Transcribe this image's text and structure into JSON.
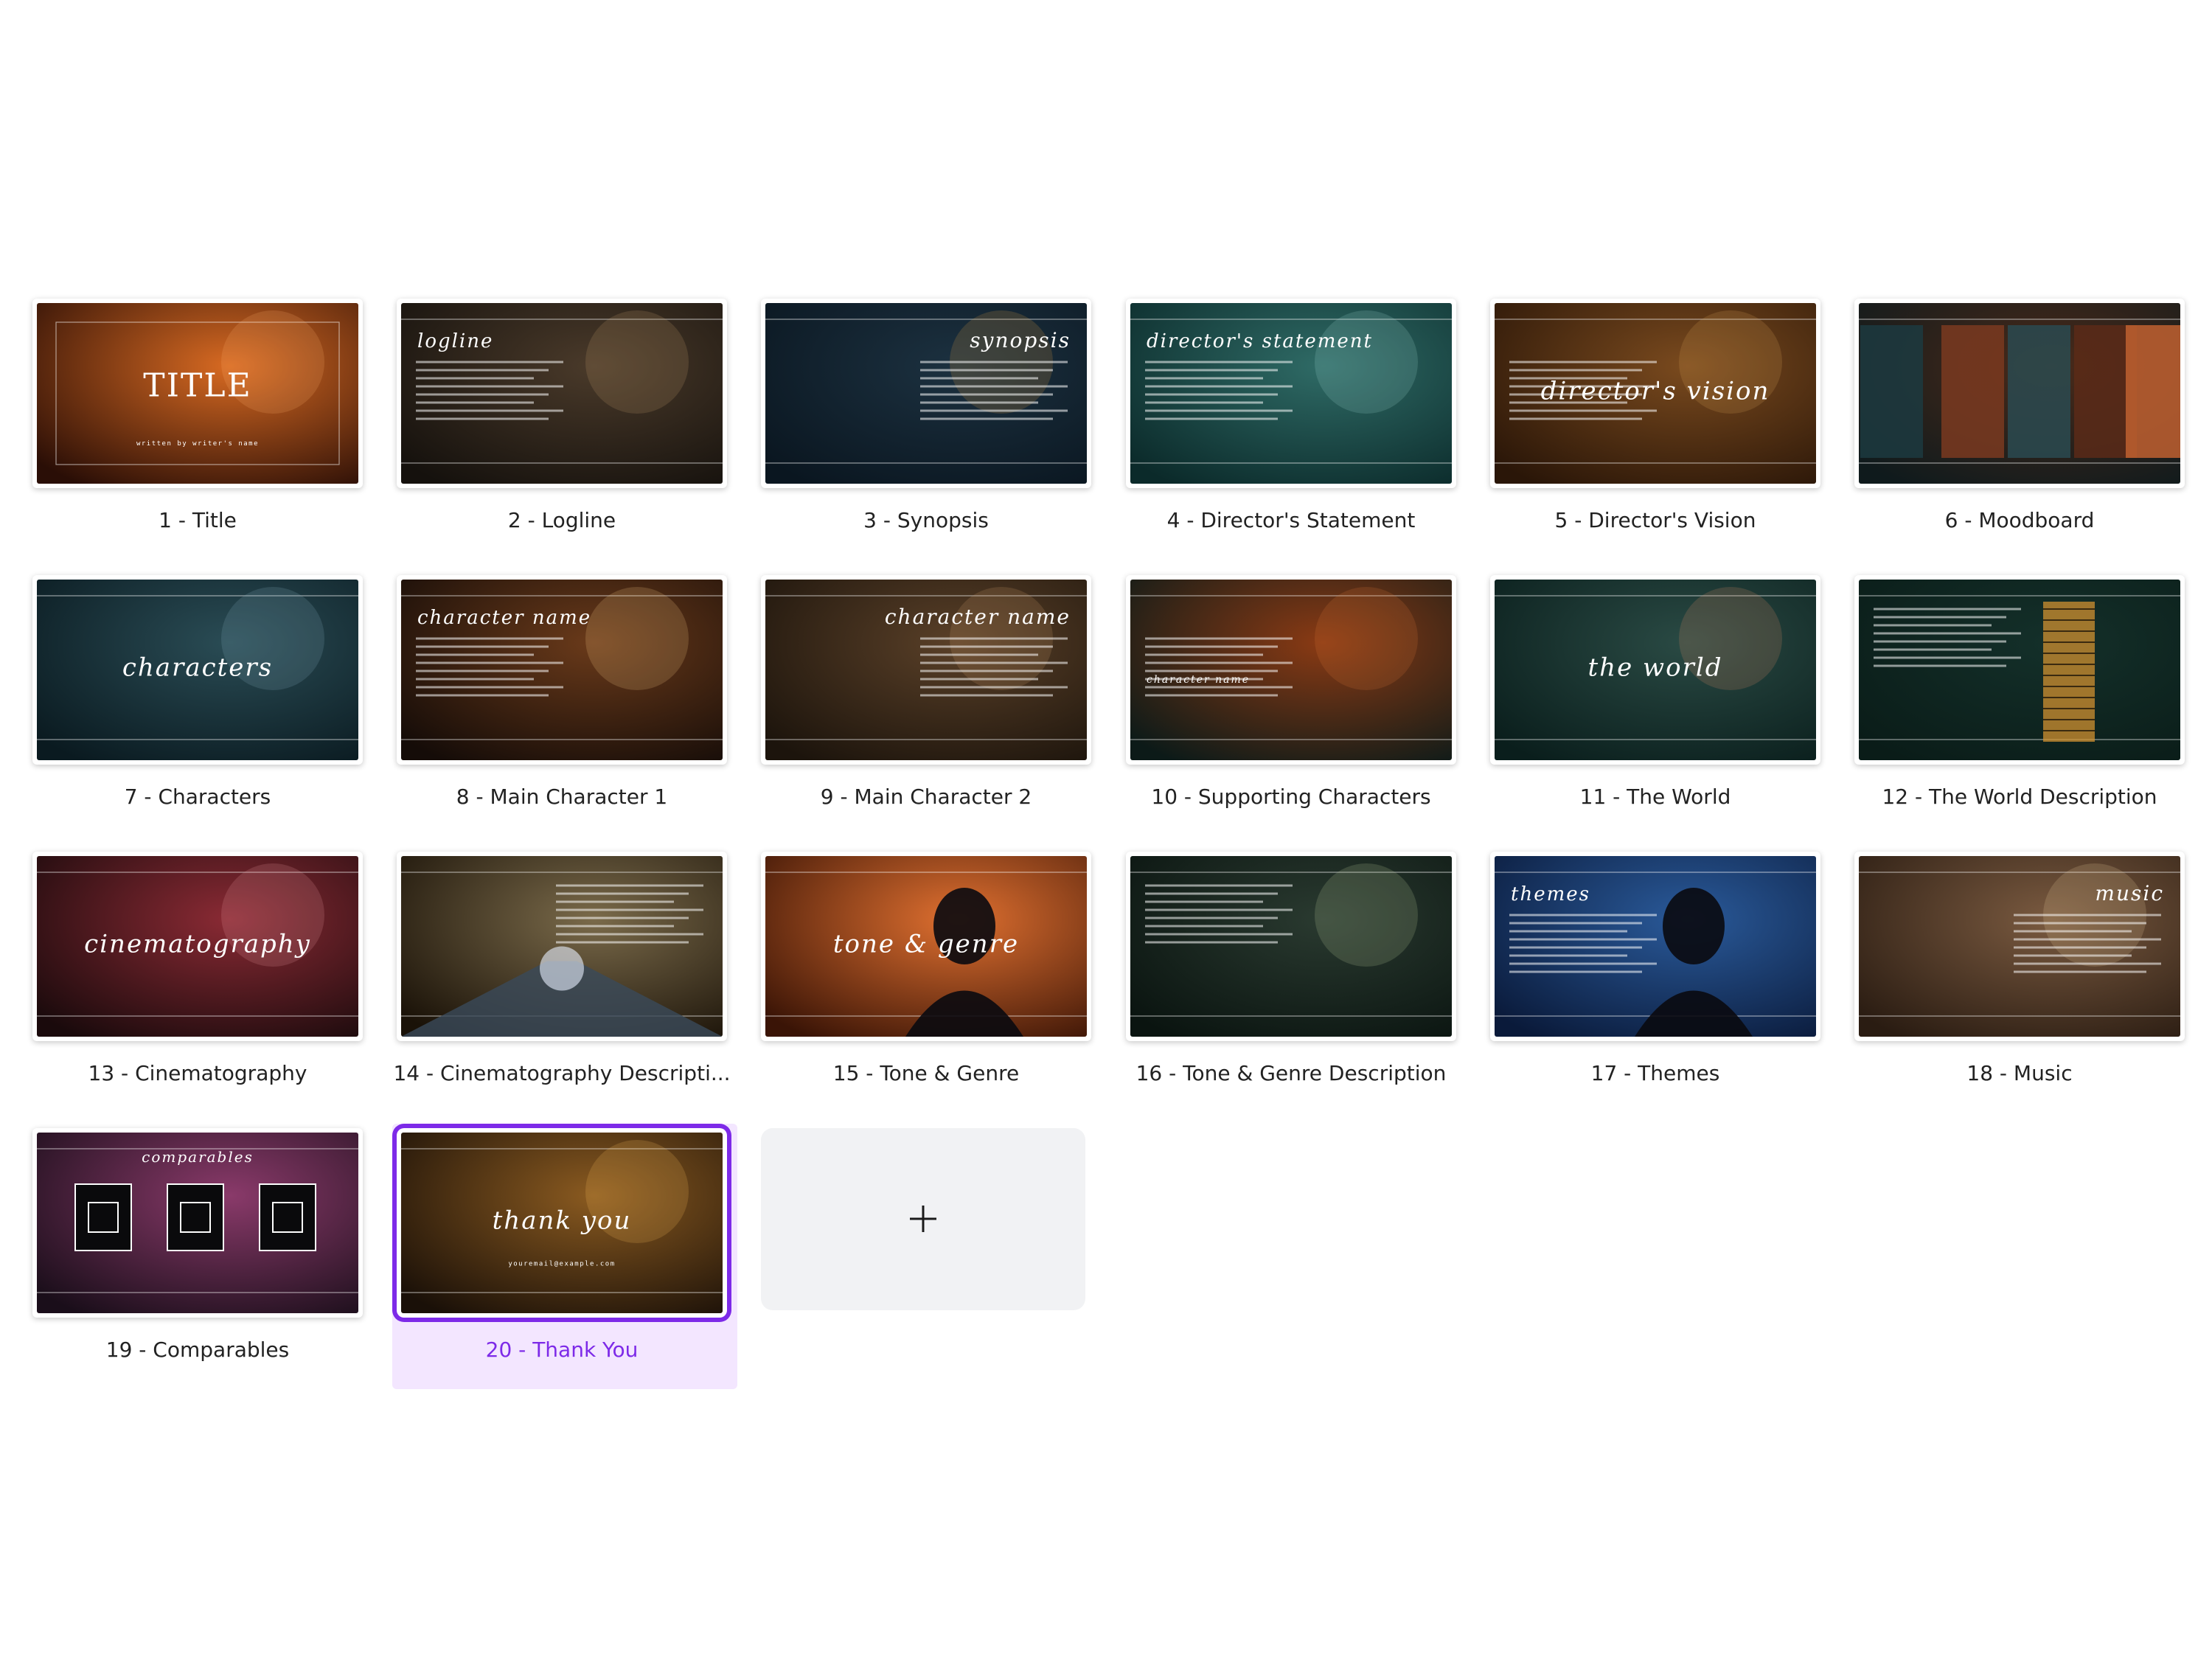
{
  "slides": [
    {
      "label": "1 - Title",
      "bg": [
        "#2a0e06",
        "#d86a22"
      ],
      "accent": "#ffb070",
      "heading": "TITLE",
      "heading_style": "upright",
      "sub": "written by writer's name",
      "body": false,
      "thumb_icon": "none"
    },
    {
      "label": "2 - Logline",
      "bg": [
        "#15110d",
        "#4a3a2a"
      ],
      "accent": "#c9a070",
      "heading": "logline",
      "heading_style": "italic-left",
      "sub": "",
      "body": true,
      "thumb_icon": "none"
    },
    {
      "label": "3 - Synopsis",
      "bg": [
        "#0a1620",
        "#1c3140"
      ],
      "accent": "#e6a040",
      "heading": "synopsis",
      "heading_style": "italic-right",
      "sub": "",
      "body": true,
      "thumb_icon": "none"
    },
    {
      "label": "4 - Director's Statement",
      "bg": [
        "#0b2a2a",
        "#2f6b66"
      ],
      "accent": "#9ed8d0",
      "heading": "director's statement",
      "heading_style": "italic-left",
      "sub": "",
      "body": true,
      "thumb_icon": "none"
    },
    {
      "label": "5 - Director's Vision",
      "bg": [
        "#2a1608",
        "#7a4a1e"
      ],
      "accent": "#e0a45a",
      "heading": "director's vision",
      "heading_style": "italic-center",
      "sub": "",
      "body": true,
      "thumb_icon": "none"
    },
    {
      "label": "6 - Moodboard",
      "bg": [
        "#0f1a1c",
        "#4a2a1a"
      ],
      "accent": "#c0603a",
      "heading": "",
      "heading_style": "none",
      "sub": "",
      "body": false,
      "thumb_icon": "collage"
    },
    {
      "label": "7 - Characters",
      "bg": [
        "#0a1a20",
        "#2a4c55"
      ],
      "accent": "#8ab4c0",
      "heading": "characters",
      "heading_style": "italic-center",
      "sub": "",
      "body": false,
      "thumb_icon": "none"
    },
    {
      "label": "8 - Main Character 1",
      "bg": [
        "#150c08",
        "#6a3a1a"
      ],
      "accent": "#ffd08a",
      "heading": "character name",
      "heading_style": "italic-left",
      "sub": "",
      "body": true,
      "thumb_icon": "none"
    },
    {
      "label": "9 - Main Character 2",
      "bg": [
        "#1c140c",
        "#5a4028"
      ],
      "accent": "#d0a070",
      "heading": "character name",
      "heading_style": "italic-right",
      "sub": "",
      "body": true,
      "thumb_icon": "none"
    },
    {
      "label": "10 - Supporting Characters",
      "bg": [
        "#0c1a18",
        "#8a3a14"
      ],
      "accent": "#e07a3a",
      "heading": "character name",
      "heading_style": "split",
      "sub": "",
      "body": true,
      "thumb_icon": "none"
    },
    {
      "label": "11 - The World",
      "bg": [
        "#0a1e1c",
        "#2a4a44"
      ],
      "accent": "#e8906a",
      "heading": "the world",
      "heading_style": "italic-center",
      "sub": "",
      "body": false,
      "thumb_icon": "none"
    },
    {
      "label": "12 - The World Description",
      "bg": [
        "#0a1c18",
        "#14302a"
      ],
      "accent": "#d09030",
      "heading": "",
      "heading_style": "none",
      "sub": "",
      "body": true,
      "thumb_icon": "building"
    },
    {
      "label": "13 - Cinematography",
      "bg": [
        "#1a0a0c",
        "#8a2a34"
      ],
      "accent": "#f0a0a8",
      "heading": "cinematography",
      "heading_style": "italic-center",
      "sub": "",
      "body": false,
      "thumb_icon": "none"
    },
    {
      "label": "14 - Cinematography Descripti...",
      "bg": [
        "#1a1208",
        "#7a6a4a"
      ],
      "accent": "#f0d090",
      "heading": "",
      "heading_style": "none",
      "sub": "",
      "body": true,
      "thumb_icon": "tunnel"
    },
    {
      "label": "15 - Tone & Genre",
      "bg": [
        "#3a1406",
        "#e07030"
      ],
      "accent": "#ffb070",
      "heading": "tone & genre",
      "heading_style": "italic-center",
      "sub": "",
      "body": false,
      "thumb_icon": "silhouette"
    },
    {
      "label": "16 - Tone & Genre Description",
      "bg": [
        "#0a1410",
        "#2a3a30"
      ],
      "accent": "#c0d0a0",
      "heading": "",
      "heading_style": "none",
      "sub": "",
      "body": true,
      "thumb_icon": "none"
    },
    {
      "label": "17 - Themes",
      "bg": [
        "#0a1a3a",
        "#2a5a9a"
      ],
      "accent": "#a0c8f0",
      "heading": "themes",
      "heading_style": "italic-left",
      "sub": "",
      "body": true,
      "thumb_icon": "silhouette"
    },
    {
      "label": "18 - Music",
      "bg": [
        "#2a1c12",
        "#7a5a40"
      ],
      "accent": "#f0d0a0",
      "heading": "music",
      "heading_style": "italic-right",
      "sub": "",
      "body": true,
      "thumb_icon": "none"
    },
    {
      "label": "19 - Comparables",
      "bg": [
        "#1a0e1a",
        "#8a3a6a"
      ],
      "accent": "#f0b0d0",
      "heading": "comparables",
      "heading_style": "italic-top",
      "sub": "",
      "body": false,
      "thumb_icon": "comparables"
    },
    {
      "label": "20 - Thank You",
      "bg": [
        "#1a1008",
        "#8a5a20"
      ],
      "accent": "#ffc060",
      "heading": "thank you",
      "heading_style": "italic-center",
      "sub": "youremail@example.com",
      "body": false,
      "thumb_icon": "none",
      "selected": true
    }
  ],
  "add_page": {
    "icon": "plus-icon"
  }
}
